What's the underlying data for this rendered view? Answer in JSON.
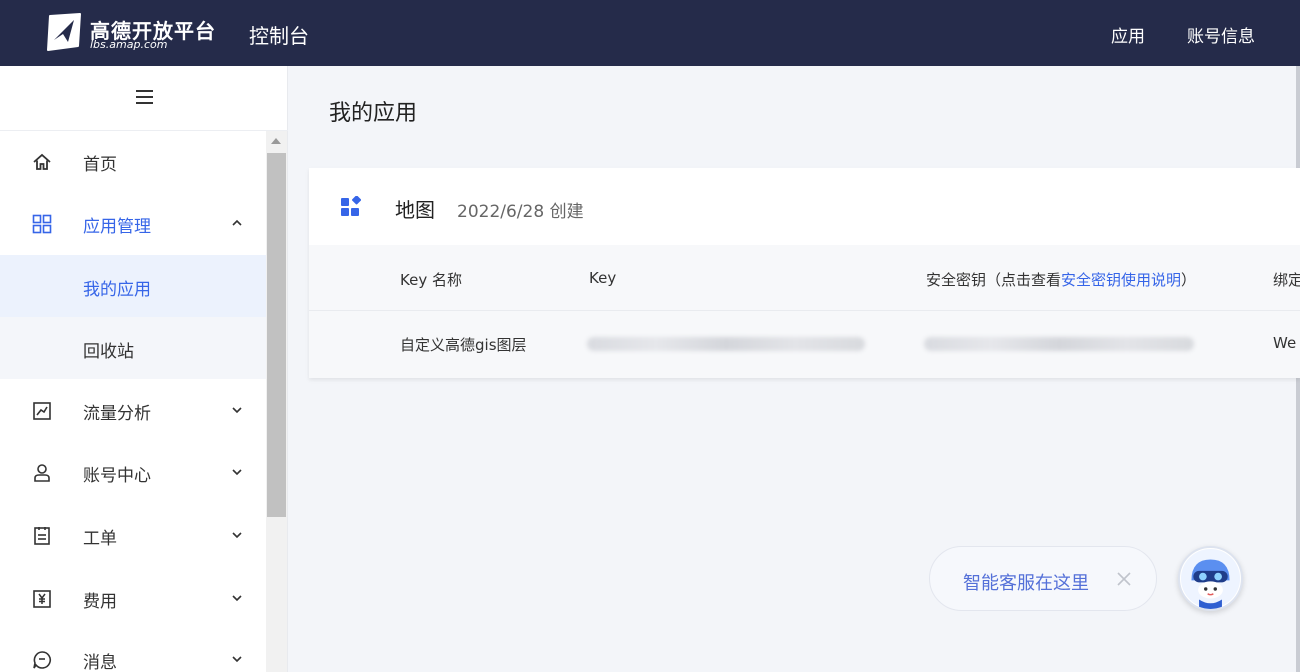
{
  "header": {
    "logo_title": "高德开放平台",
    "logo_subtitle": "lbs.amap.com",
    "console_title": "控制台",
    "nav": [
      {
        "label": "应用"
      },
      {
        "label": "账号信息"
      }
    ],
    "bg_color": "#252b4a"
  },
  "sidebar": {
    "menu_icon": "hamburger-icon",
    "items": [
      {
        "label": "首页",
        "icon": "home-icon"
      },
      {
        "label": "应用管理",
        "icon": "grid-icon",
        "expanded": true,
        "active": true,
        "children": [
          {
            "label": "我的应用",
            "selected": true
          },
          {
            "label": "回收站",
            "selected": false
          }
        ]
      },
      {
        "label": "流量分析",
        "icon": "chart-icon"
      },
      {
        "label": "账号中心",
        "icon": "user-icon"
      },
      {
        "label": "工单",
        "icon": "clipboard-icon"
      },
      {
        "label": "费用",
        "icon": "yuan-icon"
      },
      {
        "label": "消息",
        "icon": "message-icon"
      }
    ],
    "accent_color": "#3665e8"
  },
  "main": {
    "page_title": "我的应用",
    "app_card": {
      "name": "地图",
      "created": "2022/6/28 创建",
      "columns": {
        "key_name": "Key 名称",
        "key": "Key",
        "secret_prefix": "安全密钥（点击查看",
        "secret_link": "安全密钥使用说明",
        "secret_suffix": "）",
        "bind": "绑定"
      },
      "rows": [
        {
          "key_name": "自定义高德gis图层",
          "bind": "We"
        }
      ]
    }
  },
  "chat": {
    "label": "智能客服在这里",
    "close_icon": "close-icon",
    "avatar_icon": "assistant-avatar-icon"
  }
}
